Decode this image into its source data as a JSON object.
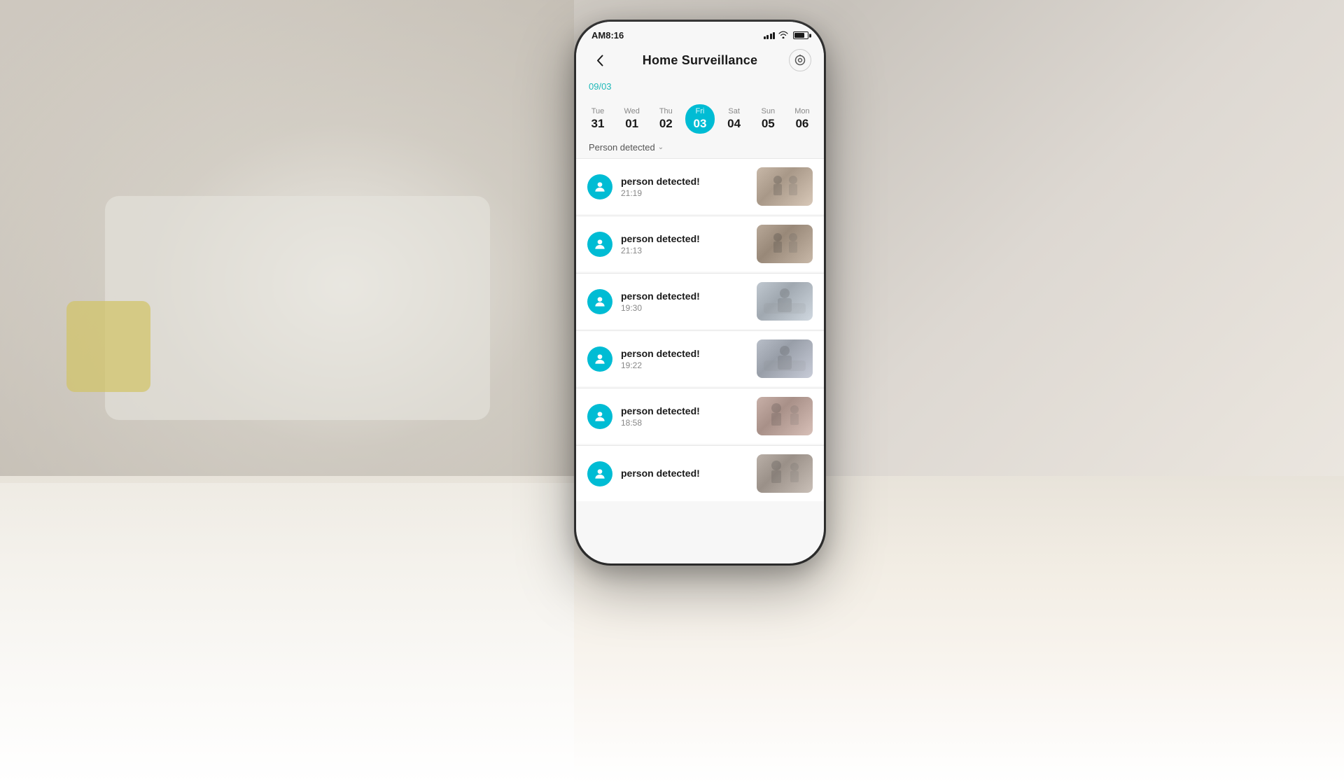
{
  "background": {
    "description": "Blurred living room background"
  },
  "phone": {
    "status_bar": {
      "time": "AM8:16",
      "signal": "full",
      "wifi": "on",
      "battery": "70"
    },
    "header": {
      "back_label": "‹",
      "title": "Home  Surveillance",
      "settings_icon": "target-icon"
    },
    "date": {
      "label": "09/03"
    },
    "days": [
      {
        "name": "Tue",
        "num": "31",
        "active": false
      },
      {
        "name": "Wed",
        "num": "01",
        "active": false
      },
      {
        "name": "Thu",
        "num": "02",
        "active": false
      },
      {
        "name": "Fri",
        "num": "03",
        "active": true
      },
      {
        "name": "Sat",
        "num": "04",
        "active": false
      },
      {
        "name": "Sun",
        "num": "05",
        "active": false
      },
      {
        "name": "Mon",
        "num": "06",
        "active": false
      }
    ],
    "filter": {
      "label": "Person detected",
      "arrow": "⌄"
    },
    "events": [
      {
        "title": "person detected!",
        "time": "21:19",
        "thumb_class": "thumb-1"
      },
      {
        "title": "person detected!",
        "time": "21:13",
        "thumb_class": "thumb-2"
      },
      {
        "title": "person detected!",
        "time": "19:30",
        "thumb_class": "thumb-3"
      },
      {
        "title": "person detected!",
        "time": "19:22",
        "thumb_class": "thumb-4"
      },
      {
        "title": "person detected!",
        "time": "18:58",
        "thumb_class": "thumb-5"
      },
      {
        "title": "person detected!",
        "time": "",
        "thumb_class": "thumb-6"
      }
    ]
  }
}
